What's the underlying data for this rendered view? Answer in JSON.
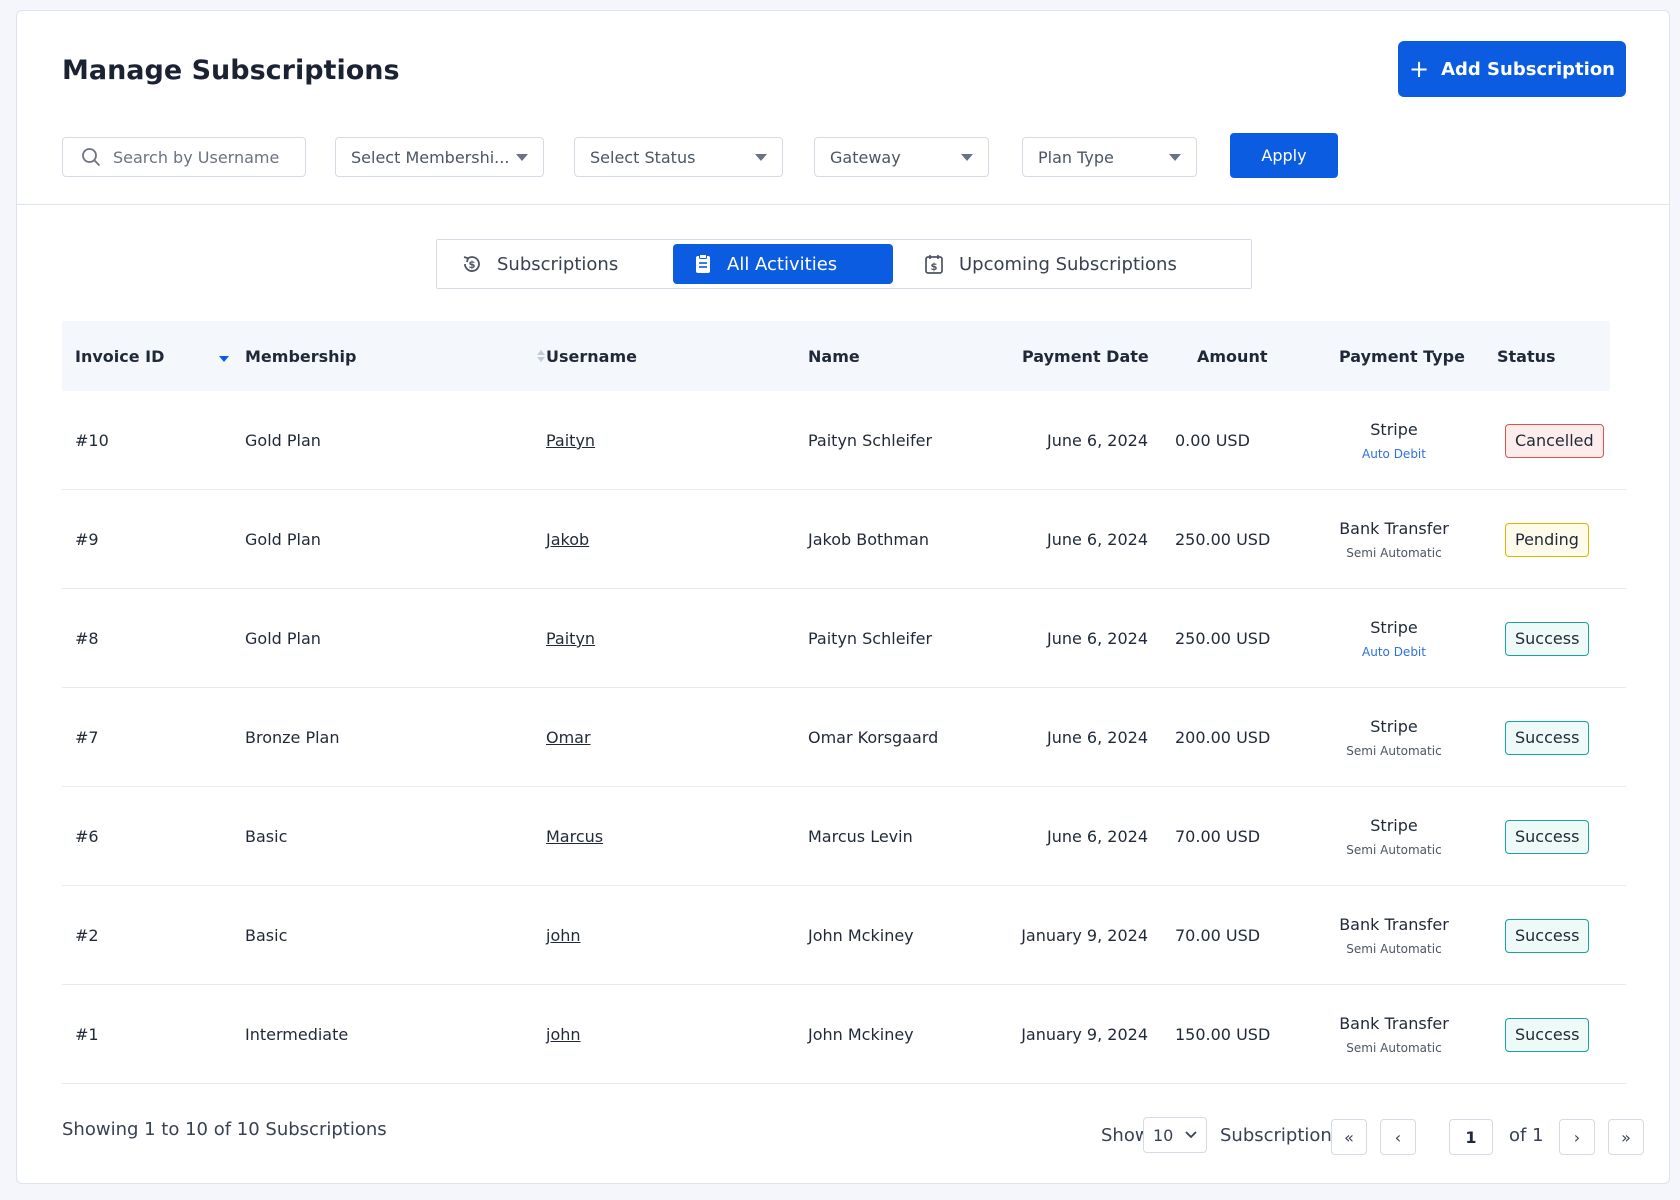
{
  "header": {
    "title": "Manage Subscriptions",
    "add_button_label": "Add Subscription"
  },
  "filters": {
    "search_placeholder": "Search by Username",
    "membership_label": "Select Membershi...",
    "status_label": "Select Status",
    "gateway_label": "Gateway",
    "plan_type_label": "Plan Type",
    "apply_label": "Apply"
  },
  "tabs": [
    {
      "label": "Subscriptions",
      "icon": "dollar-cycle-icon",
      "active": false
    },
    {
      "label": "All Activities",
      "icon": "clipboard-icon",
      "active": true
    },
    {
      "label": "Upcoming Subscriptions",
      "icon": "calendar-dollar-icon",
      "active": false
    }
  ],
  "table": {
    "columns": [
      "Invoice ID",
      "Membership",
      "Username",
      "Name",
      "Payment Date",
      "Amount",
      "Payment Type",
      "Status"
    ],
    "rows": [
      {
        "invoice": "#10",
        "membership": "Gold Plan",
        "username": "Paityn",
        "name": "Paityn Schleifer",
        "date": "June 6, 2024",
        "amount": "0.00 USD",
        "gateway": "Stripe",
        "mode": "Auto Debit",
        "status": "Cancelled"
      },
      {
        "invoice": "#9",
        "membership": "Gold Plan",
        "username": "Jakob",
        "name": "Jakob Bothman",
        "date": "June 6, 2024",
        "amount": "250.00 USD",
        "gateway": "Bank Transfer",
        "mode": "Semi Automatic",
        "status": "Pending"
      },
      {
        "invoice": "#8",
        "membership": "Gold Plan",
        "username": "Paityn",
        "name": "Paityn Schleifer",
        "date": "June 6, 2024",
        "amount": "250.00 USD",
        "gateway": "Stripe",
        "mode": "Auto Debit",
        "status": "Success"
      },
      {
        "invoice": "#7",
        "membership": "Bronze Plan",
        "username": "Omar",
        "name": "Omar Korsgaard",
        "date": "June 6, 2024",
        "amount": "200.00 USD",
        "gateway": "Stripe",
        "mode": "Semi Automatic",
        "status": "Success"
      },
      {
        "invoice": "#6",
        "membership": "Basic",
        "username": "Marcus",
        "name": "Marcus Levin",
        "date": "June 6, 2024",
        "amount": "70.00 USD",
        "gateway": "Stripe",
        "mode": "Semi Automatic",
        "status": "Success"
      },
      {
        "invoice": "#2",
        "membership": "Basic",
        "username": "john",
        "name": "John Mckiney",
        "date": "January 9, 2024",
        "amount": "70.00 USD",
        "gateway": "Bank Transfer",
        "mode": "Semi Automatic",
        "status": "Success"
      },
      {
        "invoice": "#1",
        "membership": "Intermediate",
        "username": "john",
        "name": "John Mckiney",
        "date": "January 9, 2024",
        "amount": "150.00 USD",
        "gateway": "Bank Transfer",
        "mode": "Semi Automatic",
        "status": "Success"
      }
    ]
  },
  "footer": {
    "showing_text": "Showing 1 to 10 of 10 Subscriptions",
    "show_label": "Show",
    "page_size": "10",
    "subscriptions_label": "Subscriptions",
    "current_page": "1",
    "of_pages": "of 1",
    "first_icon": "«",
    "prev_icon": "‹",
    "next_icon": "›",
    "last_icon": "»"
  },
  "colors": {
    "accent": "#0b5ce0",
    "cancelled": "#d9534f",
    "pending": "#e0b400",
    "success": "#1aa39a",
    "auto_debit": "#2f6fe0",
    "semi_automatic": "#4b5563"
  }
}
